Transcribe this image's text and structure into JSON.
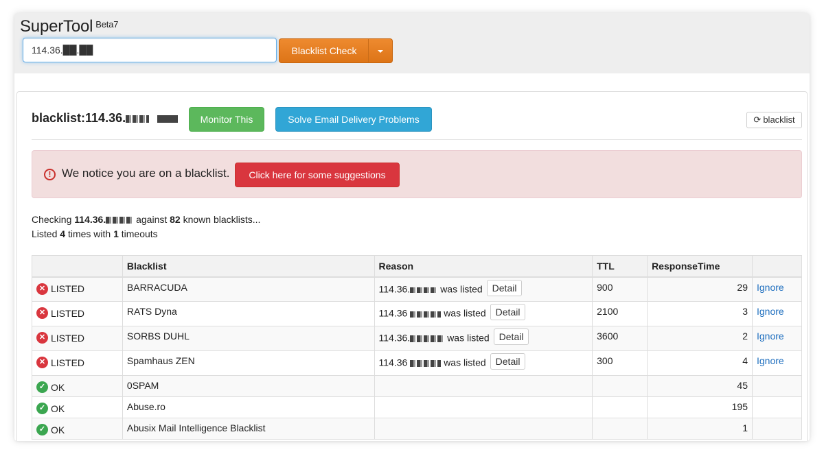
{
  "app": {
    "name": "SuperTool",
    "version": "Beta7"
  },
  "search": {
    "value": "114.36.██.██",
    "button_label": "Blacklist Check"
  },
  "panel": {
    "title": "blacklist:114.36.",
    "monitor_label": "Monitor This",
    "solve_label": "Solve Email Delivery Problems",
    "refresh_label": "blacklist"
  },
  "alert": {
    "text": "We notice you are on a blacklist.",
    "button_label": "Click here for some suggestions",
    "color": "#f2dede"
  },
  "summary": {
    "checking_prefix": "Checking",
    "ip": "114.36.",
    "against": "against",
    "count": "82",
    "known": "known blacklists...",
    "listed_prefix": "Listed",
    "listed_count": "4",
    "times_with": "times with",
    "timeouts_count": "1",
    "timeouts": "timeouts"
  },
  "table": {
    "headers": [
      "",
      "Blacklist",
      "Reason",
      "TTL",
      "ResponseTime",
      ""
    ],
    "rows": [
      {
        "status": "LISTED",
        "blacklist": "BARRACUDA",
        "reason_ip": "114.36.",
        "reason_text": "was listed",
        "detail": "Detail",
        "ttl": "900",
        "response": "29",
        "action": "Ignore"
      },
      {
        "status": "LISTED",
        "blacklist": "RATS Dyna",
        "reason_ip": "114.36",
        "reason_text": "was listed",
        "detail": "Detail",
        "ttl": "2100",
        "response": "3",
        "action": "Ignore"
      },
      {
        "status": "LISTED",
        "blacklist": "SORBS DUHL",
        "reason_ip": "114.36.",
        "reason_text": "was listed",
        "detail": "Detail",
        "ttl": "3600",
        "response": "2",
        "action": "Ignore"
      },
      {
        "status": "LISTED",
        "blacklist": "Spamhaus ZEN",
        "reason_ip": "114.36",
        "reason_text": "was listed",
        "detail": "Detail",
        "ttl": "300",
        "response": "4",
        "action": "Ignore"
      },
      {
        "status": "OK",
        "blacklist": "0SPAM",
        "response": "45"
      },
      {
        "status": "OK",
        "blacklist": "Abuse.ro",
        "response": "195"
      },
      {
        "status": "OK",
        "blacklist": "Abusix Mail Intelligence Blacklist",
        "response": "1"
      }
    ]
  },
  "colors": {
    "accent_orange": "#e67e22",
    "success": "#5cb85c",
    "info": "#31a6d6",
    "danger": "#d9363e"
  }
}
